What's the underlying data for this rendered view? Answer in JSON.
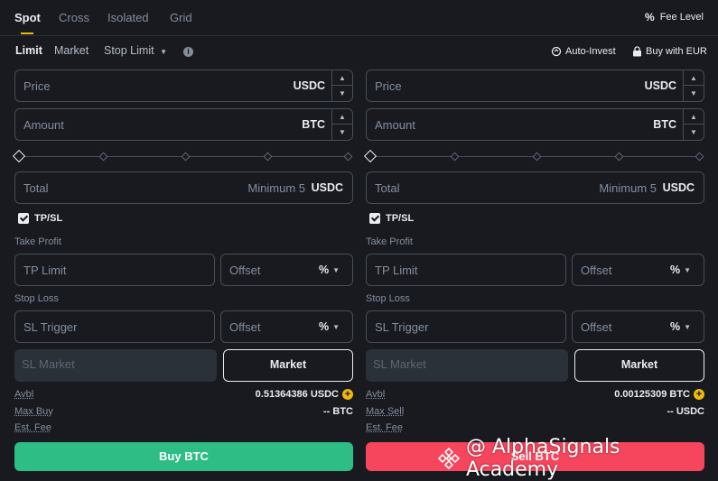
{
  "tabs": [
    {
      "label": "Spot",
      "active": true
    },
    {
      "label": "Cross",
      "active": false
    },
    {
      "label": "Isolated",
      "active": false
    },
    {
      "label": "Grid",
      "active": false
    }
  ],
  "fee_level": "Fee Level",
  "order_types": [
    {
      "label": "Limit",
      "active": true
    },
    {
      "label": "Market",
      "active": false
    },
    {
      "label": "Stop Limit",
      "active": false
    }
  ],
  "auto_invest": "Auto-Invest",
  "buy_with": "Buy with EUR",
  "buy": {
    "price_label": "Price",
    "price_unit": "USDC",
    "amount_label": "Amount",
    "amount_unit": "BTC",
    "total_label": "Total",
    "total_min": "Minimum 5",
    "total_unit": "USDC",
    "tpsl_label": "TP/SL",
    "take_profit_label": "Take Profit",
    "tp_limit_label": "TP Limit",
    "offset_label": "Offset",
    "offset_unit": "%",
    "stop_loss_label": "Stop Loss",
    "sl_trigger_label": "SL Trigger",
    "offset2_label": "Offset",
    "offset2_unit": "%",
    "sl_market_label": "SL Market",
    "market_button": "Market",
    "avbl_label": "Avbl",
    "avbl_value": "0.51364386 USDC",
    "max_label": "Max Buy",
    "max_value": "-- BTC",
    "fee_label": "Est. Fee",
    "action_label": "Buy BTC"
  },
  "sell": {
    "price_label": "Price",
    "price_unit": "USDC",
    "amount_label": "Amount",
    "amount_unit": "BTC",
    "total_label": "Total",
    "total_min": "Minimum 5",
    "total_unit": "USDC",
    "tpsl_label": "TP/SL",
    "take_profit_label": "Take Profit",
    "tp_limit_label": "TP Limit",
    "offset_label": "Offset",
    "offset_unit": "%",
    "stop_loss_label": "Stop Loss",
    "sl_trigger_label": "SL Trigger",
    "offset2_label": "Offset",
    "offset2_unit": "%",
    "sl_market_label": "SL Market",
    "market_button": "Market",
    "avbl_label": "Avbl",
    "avbl_value": "0.00125309 BTC",
    "max_label": "Max Sell",
    "max_value": "-- USDC",
    "fee_label": "Est. Fee",
    "action_label": "Sell BTC"
  },
  "watermark": "@ AlphaSignals Academy",
  "colors": {
    "buy": "#2ebd85",
    "sell": "#f6465d",
    "accent": "#f0b90b",
    "background": "#181a20"
  }
}
